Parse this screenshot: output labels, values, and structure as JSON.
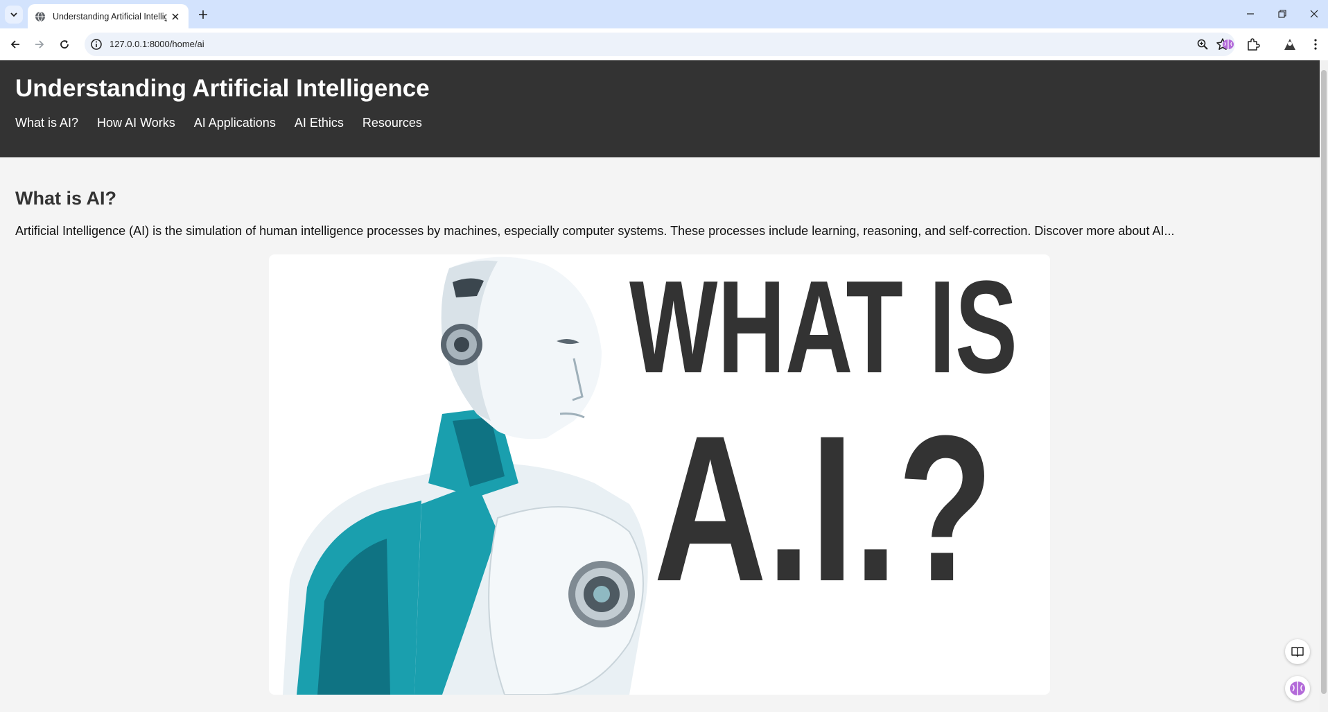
{
  "browser": {
    "tab_title": "Understanding Artificial Intelligence",
    "url": "127.0.0.1:8000/home/ai"
  },
  "site": {
    "title": "Understanding Artificial Intelligence",
    "nav": [
      {
        "label": "What is AI?"
      },
      {
        "label": "How AI Works"
      },
      {
        "label": "AI Applications"
      },
      {
        "label": "AI Ethics"
      },
      {
        "label": "Resources"
      }
    ]
  },
  "section": {
    "heading": "What is AI?",
    "text": "Artificial Intelligence (AI) is the simulation of human intelligence processes by machines, especially computer systems. These processes include learning, reasoning, and self-correction. Discover more about AI..."
  },
  "hero_image": {
    "caption_line1": "WHAT IS",
    "caption_line2": "A.I.?"
  },
  "icons": {
    "tab_search": "chevron-down-icon",
    "favicon": "globe-icon",
    "close": "close-icon",
    "new_tab": "plus-icon",
    "back": "arrow-left-icon",
    "forward": "arrow-right-icon",
    "reload": "reload-icon",
    "site_info": "info-icon",
    "zoom": "zoom-icon",
    "bookmark": "star-icon",
    "extension_brain": "brain-icon",
    "extensions": "puzzle-icon",
    "profile": "profile-icon",
    "menu": "kebab-menu-icon",
    "reader": "book-icon"
  },
  "colors": {
    "header_bg": "#333333",
    "page_bg": "#f4f4f4",
    "robot_teal": "#1a9fae",
    "caption_text": "#333333"
  }
}
